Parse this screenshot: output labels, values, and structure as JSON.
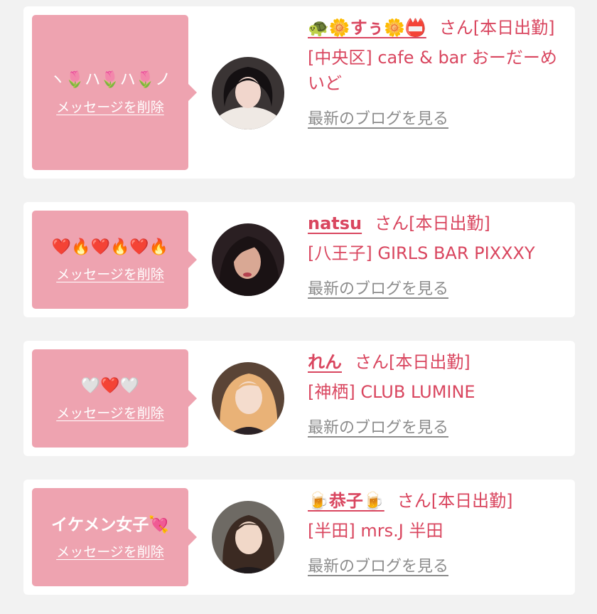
{
  "cards": [
    {
      "message": "ヽ🌷ハ🌷ハ🌷ノ",
      "delete_label": "メッセージを削除",
      "name": "🐢🌼すぅ🌼📛",
      "suffix": "さん[本日出勤]",
      "shop": "[中央区] cafe & bar おーだーめいど",
      "blog_label": "最新のブログを見る"
    },
    {
      "message": "❤️🔥❤️🔥❤️🔥",
      "delete_label": "メッセージを削除",
      "name": "natsu",
      "suffix": "さん[本日出勤]",
      "shop": "[八王子] GIRLS BAR PIXXXY",
      "blog_label": "最新のブログを見る"
    },
    {
      "message": "🤍❤️🤍",
      "delete_label": "メッセージを削除",
      "name": "れん",
      "suffix": "さん[本日出勤]",
      "shop": "[神栖] CLUB LUMINE",
      "blog_label": "最新のブログを見る"
    },
    {
      "message": "イケメン女子💘",
      "delete_label": "メッセージを削除",
      "name": "🍺恭子🍺",
      "suffix": "さん[本日出勤]",
      "shop": "[半田] mrs.J 半田",
      "blog_label": "最新のブログを見る"
    }
  ],
  "colors": {
    "bubble": "#eea3b0",
    "accent": "#d9465f",
    "link_gray": "#8c8c8c",
    "page_bg": "#f2f2f2"
  }
}
